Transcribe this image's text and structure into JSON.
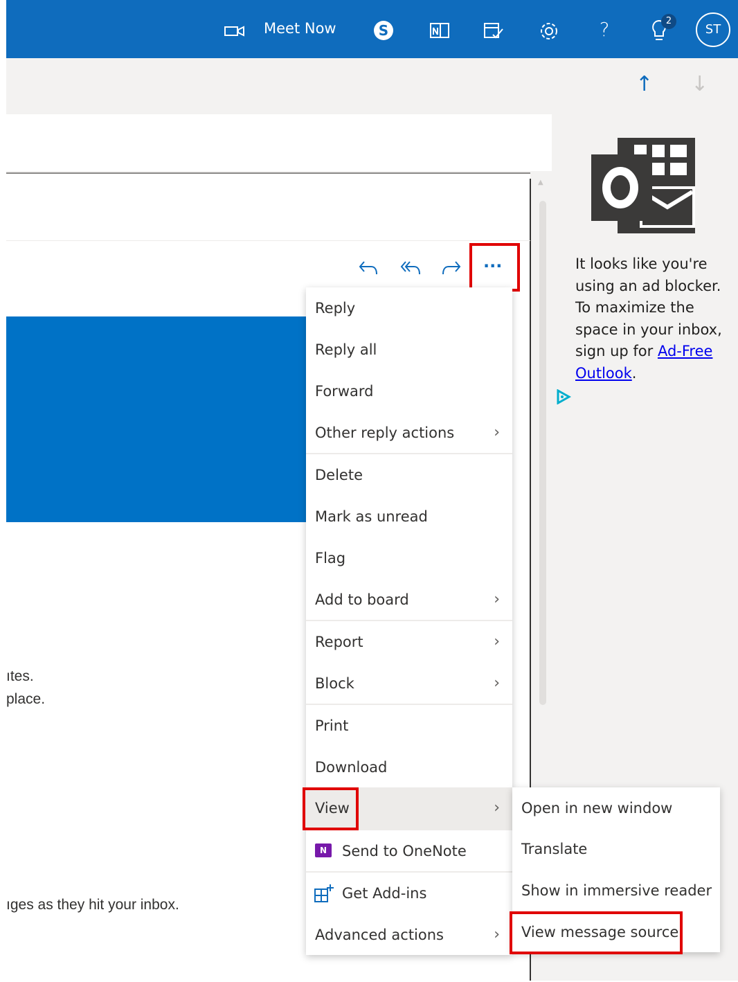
{
  "topbar": {
    "meet_now_label": "Meet Now",
    "avatar_initials": "ST",
    "badge_count": "2",
    "help_glyph": "?",
    "icons": [
      "video-camera-icon",
      "skype-icon",
      "onenote-feed-icon",
      "my-day-icon",
      "settings-icon",
      "help-icon",
      "tips-icon"
    ]
  },
  "nav": {
    "up_arrow": "↑",
    "down_arrow": "↓"
  },
  "actions": {
    "more_label": "···"
  },
  "body_fragments": {
    "line1": "ıtes.",
    "line2": "place.",
    "line3": "ıges as they hit your inbox."
  },
  "main_menu": {
    "items": [
      {
        "label": "Reply",
        "submenu": false
      },
      {
        "label": "Reply all",
        "submenu": false
      },
      {
        "label": "Forward",
        "submenu": false
      },
      {
        "label": "Other reply actions",
        "submenu": true
      },
      {
        "label": "Delete",
        "submenu": false
      },
      {
        "label": "Mark as unread",
        "submenu": false
      },
      {
        "label": "Flag",
        "submenu": false
      },
      {
        "label": "Add to board",
        "submenu": true
      },
      {
        "label": "Report",
        "submenu": true
      },
      {
        "label": "Block",
        "submenu": true
      },
      {
        "label": "Print",
        "submenu": false
      },
      {
        "label": "Download",
        "submenu": false
      },
      {
        "label": "View",
        "submenu": true
      },
      {
        "label": "Send to OneNote",
        "submenu": false
      },
      {
        "label": "Get Add-ins",
        "submenu": false
      },
      {
        "label": "Advanced actions",
        "submenu": true
      }
    ]
  },
  "view_submenu": {
    "items": [
      {
        "label": "Open in new window"
      },
      {
        "label": "Translate"
      },
      {
        "label": "Show in immersive reader"
      },
      {
        "label": "View message source"
      }
    ]
  },
  "ad": {
    "text_before": "It looks like you're using an ad blocker. To maximize the space in your inbox, sign up for ",
    "link_text": "Ad-Free Outlook",
    "text_after": "."
  },
  "colors": {
    "brand": "#0f6cbd",
    "banner": "#0072c6",
    "highlight": "#e00000"
  }
}
